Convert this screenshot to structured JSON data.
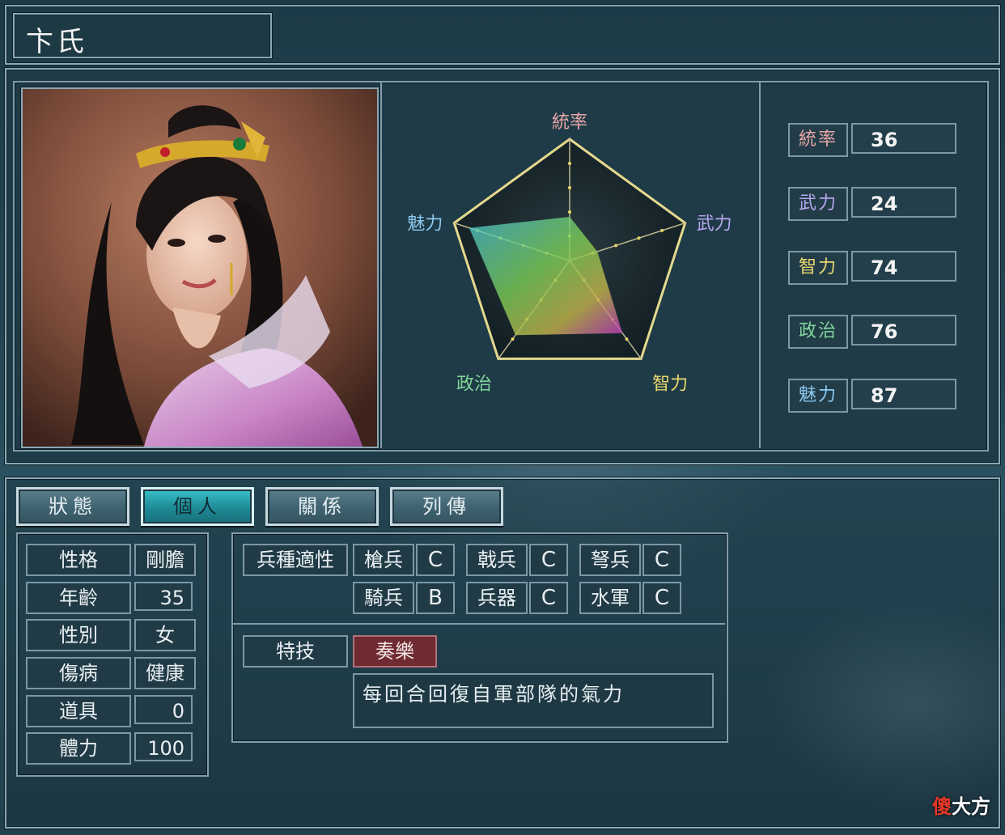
{
  "officer": {
    "name": "卞氏"
  },
  "radar": {
    "labels": {
      "tong": "統率",
      "wu": "武力",
      "zhi": "智力",
      "zheng": "政治",
      "mei": "魅力"
    },
    "values": {
      "tong": 36,
      "wu": 24,
      "zhi": 74,
      "zheng": 76,
      "mei": 87
    },
    "max": 100
  },
  "stats": [
    {
      "label": "統率",
      "value": "36",
      "color": "#e7a7a7"
    },
    {
      "label": "武力",
      "value": "24",
      "color": "#b6a6ee"
    },
    {
      "label": "智力",
      "value": "74",
      "color": "#e9d86e"
    },
    {
      "label": "政治",
      "value": "76",
      "color": "#7fd59a"
    },
    {
      "label": "魅力",
      "value": "87",
      "color": "#8ac7ee"
    }
  ],
  "tabs": [
    {
      "label": "狀態",
      "active": false
    },
    {
      "label": "個人",
      "active": true
    },
    {
      "label": "關係",
      "active": false
    },
    {
      "label": "列傳",
      "active": false
    }
  ],
  "personal": [
    {
      "label": "性格",
      "value": "剛膽"
    },
    {
      "label": "年齡",
      "value": "35"
    },
    {
      "label": "性別",
      "value": "女"
    },
    {
      "label": "傷病",
      "value": "健康"
    },
    {
      "label": "道具",
      "value": "0"
    },
    {
      "label": "體力",
      "value": "100"
    }
  ],
  "aptitude": {
    "title": "兵種適性",
    "row1": [
      {
        "unit": "槍兵",
        "grade": "C"
      },
      {
        "unit": "戟兵",
        "grade": "C"
      },
      {
        "unit": "弩兵",
        "grade": "C"
      }
    ],
    "row2": [
      {
        "unit": "騎兵",
        "grade": "B"
      },
      {
        "unit": "兵器",
        "grade": "C"
      },
      {
        "unit": "水軍",
        "grade": "C"
      }
    ]
  },
  "skill": {
    "title": "特技",
    "name": "奏樂",
    "description": "每回合回復自軍部隊的氣力"
  },
  "watermark": {
    "part1": "傻",
    "part2": "大方"
  },
  "colors": {
    "accent_active_tab": "#1e8a96",
    "skill_bg": "#6f2b31"
  }
}
